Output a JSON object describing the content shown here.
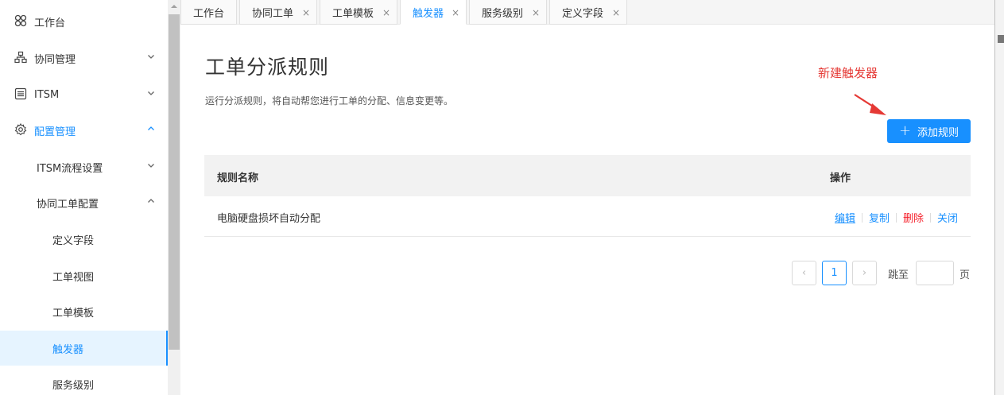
{
  "sidebar": {
    "items": [
      {
        "label": "工作台",
        "icon": "dashboard-icon"
      },
      {
        "label": "协同管理",
        "icon": "org-chart-icon"
      },
      {
        "label": "ITSM",
        "icon": "list-icon"
      },
      {
        "label": "配置管理",
        "icon": "gear-icon"
      },
      {
        "label": "ITSM流程设置"
      },
      {
        "label": "协同工单配置"
      },
      {
        "label": "定义字段"
      },
      {
        "label": "工单视图"
      },
      {
        "label": "工单模板"
      },
      {
        "label": "触发器"
      },
      {
        "label": "服务级别"
      }
    ]
  },
  "tabs": [
    {
      "label": "工作台"
    },
    {
      "label": "协同工单"
    },
    {
      "label": "工单模板"
    },
    {
      "label": "触发器"
    },
    {
      "label": "服务级别"
    },
    {
      "label": "定义字段"
    }
  ],
  "tab_close": "×",
  "main": {
    "title": "工单分派规则",
    "subtitle": "运行分派规则，将自动帮您进行工单的分配、信息变更等。",
    "annotation": "新建触发器",
    "add_button": "添加规则",
    "add_plus": "+",
    "table": {
      "headers": [
        "规则名称",
        "操作"
      ],
      "rows": [
        {
          "name": "电脑硬盘损坏自动分配",
          "actions": [
            "编辑",
            "复制",
            "删除",
            "关闭"
          ]
        }
      ]
    },
    "pagination": {
      "prev": "‹",
      "current": "1",
      "next": "›",
      "jump_label": "跳至",
      "page_label": "页"
    }
  },
  "colors": {
    "accent": "#1890ff",
    "danger": "#f5222d",
    "annotation": "#e53935"
  }
}
